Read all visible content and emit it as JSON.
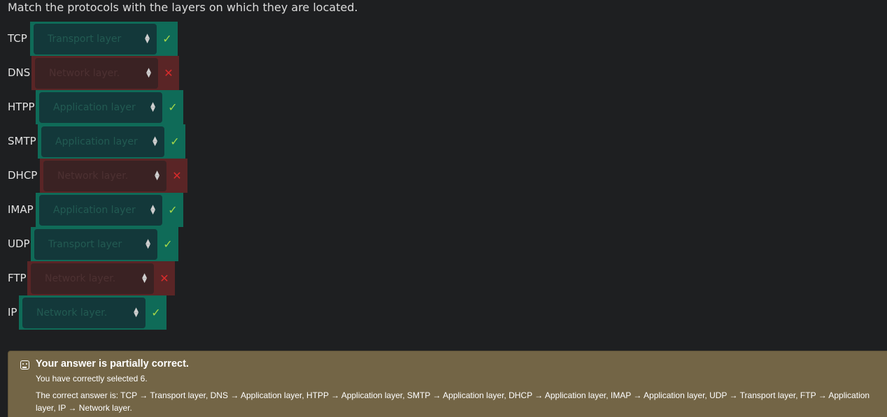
{
  "question": "Match the protocols with the layers on which they are located.",
  "rows": [
    {
      "protocol": "TCP",
      "selected": "Transport layer",
      "status": "correct",
      "mark": "✓"
    },
    {
      "protocol": "DNS",
      "selected": "Network layer.",
      "status": "incorrect",
      "mark": "✕"
    },
    {
      "protocol": "HTPP",
      "selected": "Application layer",
      "status": "correct",
      "mark": "✓"
    },
    {
      "protocol": "SMTP",
      "selected": "Application layer",
      "status": "correct",
      "mark": "✓"
    },
    {
      "protocol": "DHCP",
      "selected": "Network layer.",
      "status": "incorrect",
      "mark": "✕"
    },
    {
      "protocol": "IMAP",
      "selected": "Application layer",
      "status": "correct",
      "mark": "✓"
    },
    {
      "protocol": "UDP",
      "selected": "Transport layer",
      "status": "correct",
      "mark": "✓"
    },
    {
      "protocol": "FTP",
      "selected": "Network layer.",
      "status": "incorrect",
      "mark": "✕"
    },
    {
      "protocol": "IP",
      "selected": "Network layer.",
      "status": "correct",
      "mark": "✓"
    }
  ],
  "feedback": {
    "icon": "neutral-face-icon",
    "title": "Your answer is partially correct.",
    "selected_count": "You have correctly selected 6.",
    "correct_answer": "The correct answer is: TCP → Transport layer, DNS → Application layer, HTPP → Application layer, SMTP → Application layer, DHCP → Application layer, IMAP → Application layer, UDP → Transport layer, FTP → Application layer, IP → Network layer."
  },
  "colors": {
    "background": "#1e1f21",
    "correct": "#0f6b58",
    "incorrect": "#5a2526",
    "feedback_bg": "#736546",
    "check": "#a4d64a",
    "cross": "#d92b2b"
  }
}
